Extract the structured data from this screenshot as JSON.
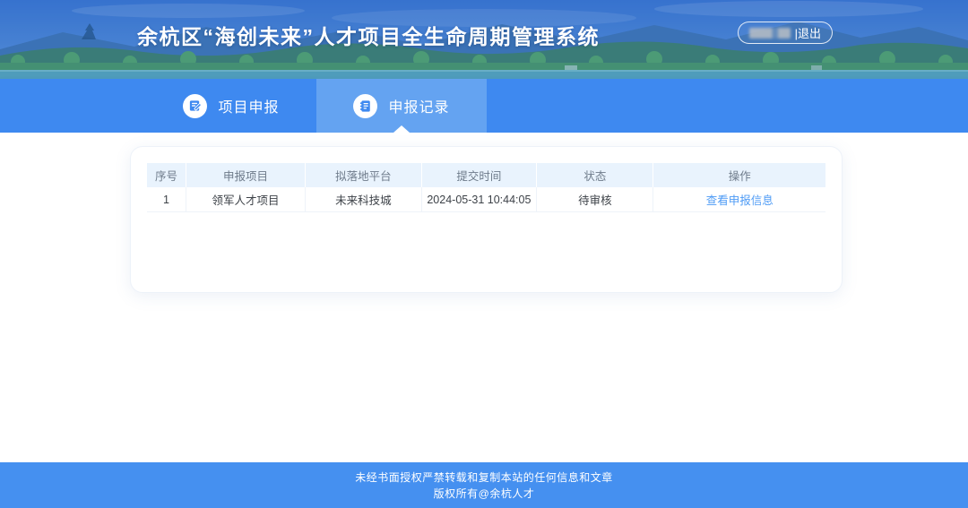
{
  "header": {
    "title": "余杭区“海创未来”人才项目全生命周期管理系统",
    "logout_label": "|退出"
  },
  "nav": {
    "tabs": [
      {
        "label": "项目申报",
        "icon": "edit-document-icon",
        "active": false
      },
      {
        "label": "申报记录",
        "icon": "records-notebook-icon",
        "active": true
      }
    ]
  },
  "records": {
    "columns": [
      "序号",
      "申报项目",
      "拟落地平台",
      "提交时间",
      "状态",
      "操作"
    ],
    "rows": [
      {
        "no": "1",
        "project": "领军人才项目",
        "platform": "未来科技城",
        "submitted_at": "2024-05-31 10:44:05",
        "status": "待审核",
        "action_label": "查看申报信息"
      }
    ]
  },
  "footer": {
    "line1": "未经书面授权严禁转载和复制本站的任何信息和文章",
    "line2": "版权所有@余杭人才"
  },
  "colors": {
    "navbar_blue": "#3E89F0",
    "active_tab_blue": "#64A3F1",
    "footer_blue": "#4590F0",
    "table_header_bg": "#E9F3FD",
    "link_blue": "#4E9BF5"
  }
}
